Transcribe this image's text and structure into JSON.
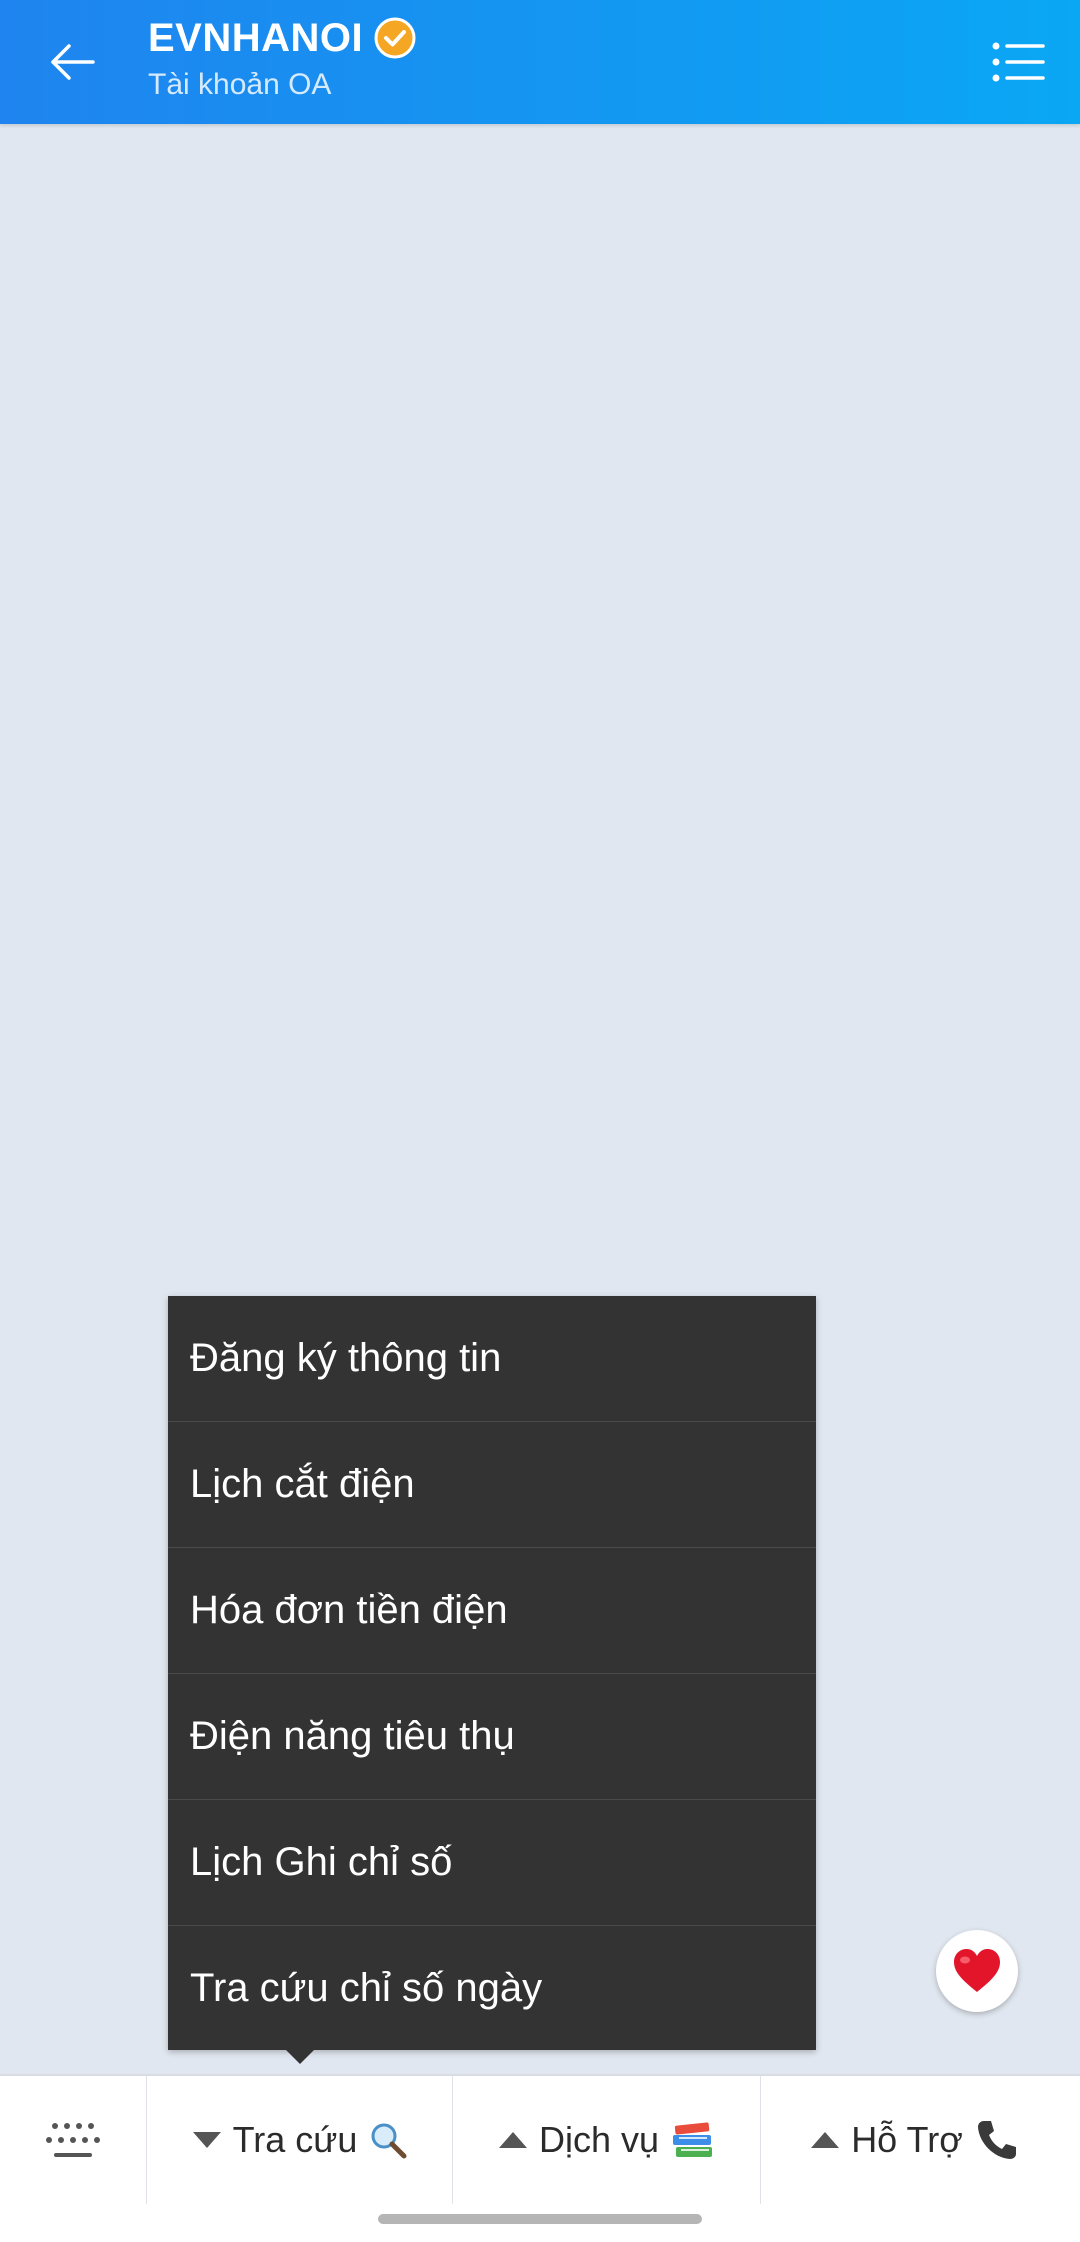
{
  "header": {
    "title": "EVNHANOI",
    "subtitle": "Tài khoản OA",
    "back_icon": "arrow-left-icon",
    "verified_icon": "verified-check-icon",
    "menu_icon": "list-menu-icon",
    "gradient_start": "#1f84ef",
    "gradient_end": "#0aa7f4"
  },
  "popup_menu": {
    "items": [
      {
        "label": "Đăng ký thông tin"
      },
      {
        "label": "Lịch cắt điện"
      },
      {
        "label": "Hóa đơn tiền điện"
      },
      {
        "label": "Điện năng tiêu thụ"
      },
      {
        "label": "Lịch Ghi chỉ số"
      },
      {
        "label": "Tra cứu chỉ số ngày"
      }
    ],
    "background": "#333333"
  },
  "reaction_button": {
    "icon": "heart-icon",
    "color": "#e2152b"
  },
  "bottom_menu": {
    "keyboard_icon": "keyboard-dots-icon",
    "tabs": [
      {
        "label": "Tra cứu",
        "caret": "down",
        "icon": "magnifier-icon"
      },
      {
        "label": "Dịch vụ",
        "caret": "up",
        "icon": "books-icon"
      },
      {
        "label": "Hỗ Trợ",
        "caret": "up",
        "icon": "phone-icon"
      }
    ]
  }
}
